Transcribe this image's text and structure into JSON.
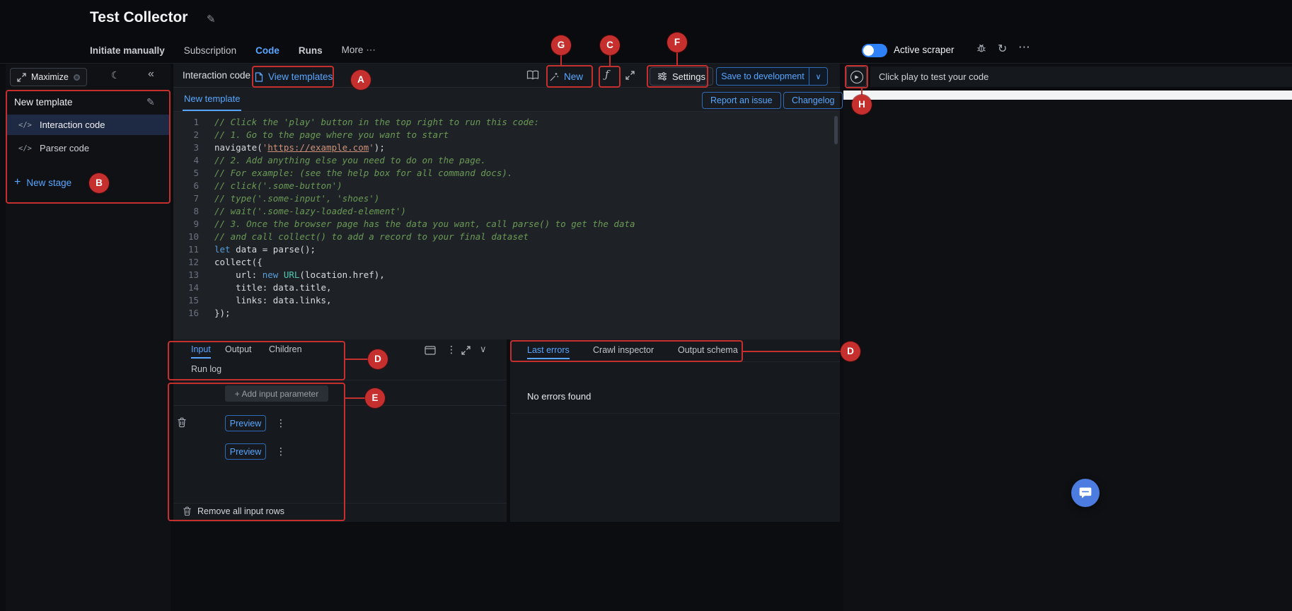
{
  "header": {
    "title": "Test Collector",
    "nav": [
      {
        "label": "Initiate manually"
      },
      {
        "label": "Subscription"
      },
      {
        "label": "Code"
      },
      {
        "label": "Runs"
      },
      {
        "label": "More"
      }
    ],
    "active_scraper": "Active scraper"
  },
  "sidebar": {
    "maximize": "Maximize",
    "template_title": "New template",
    "items": [
      {
        "label": "Interaction code"
      },
      {
        "label": "Parser code"
      }
    ],
    "new_stage": "New stage"
  },
  "editor": {
    "title": "Interaction code",
    "view_templates": "View templates",
    "new_button": "New",
    "settings": "Settings",
    "save": "Save to development",
    "tab": "New template",
    "report_issue": "Report an issue",
    "changelog": "Changelog"
  },
  "code": {
    "lines": [
      {
        "n": 1,
        "tokens": [
          {
            "t": "// Click the 'play' button in the top right to run this code:",
            "c": "comment"
          }
        ]
      },
      {
        "n": 2,
        "tokens": [
          {
            "t": "// 1. Go to the page where you want to start",
            "c": "comment"
          }
        ]
      },
      {
        "n": 3,
        "tokens": [
          {
            "t": "navigate(",
            "c": "plain"
          },
          {
            "t": "'",
            "c": "str"
          },
          {
            "t": "https://example.com",
            "c": "strlink"
          },
          {
            "t": "'",
            "c": "str"
          },
          {
            "t": ");",
            "c": "plain"
          }
        ]
      },
      {
        "n": 4,
        "tokens": [
          {
            "t": "// 2. Add anything else you need to do on the page.",
            "c": "comment"
          }
        ]
      },
      {
        "n": 5,
        "tokens": [
          {
            "t": "// For example: (see the help box for all command docs).",
            "c": "comment"
          }
        ]
      },
      {
        "n": 6,
        "tokens": [
          {
            "t": "// click('.some-button')",
            "c": "comment"
          }
        ]
      },
      {
        "n": 7,
        "tokens": [
          {
            "t": "// type('.some-input', 'shoes')",
            "c": "comment"
          }
        ]
      },
      {
        "n": 8,
        "tokens": [
          {
            "t": "// wait('.some-lazy-loaded-element')",
            "c": "comment"
          }
        ]
      },
      {
        "n": 9,
        "tokens": [
          {
            "t": "// 3. Once the browser page has the data you want, call parse() to get the data",
            "c": "comment"
          }
        ]
      },
      {
        "n": 10,
        "tokens": [
          {
            "t": "// and call collect() to add a record to your final dataset",
            "c": "comment"
          }
        ]
      },
      {
        "n": 11,
        "tokens": [
          {
            "t": "let ",
            "c": "kw"
          },
          {
            "t": "data = parse();",
            "c": "plain"
          }
        ]
      },
      {
        "n": 12,
        "tokens": [
          {
            "t": "collect({",
            "c": "plain"
          }
        ]
      },
      {
        "n": 13,
        "tokens": [
          {
            "t": "    url: ",
            "c": "plain"
          },
          {
            "t": "new ",
            "c": "kw"
          },
          {
            "t": "URL",
            "c": "type"
          },
          {
            "t": "(location.href),",
            "c": "plain"
          }
        ]
      },
      {
        "n": 14,
        "tokens": [
          {
            "t": "    title: data.title,",
            "c": "plain"
          }
        ]
      },
      {
        "n": 15,
        "tokens": [
          {
            "t": "    links: data.links,",
            "c": "plain"
          }
        ]
      },
      {
        "n": 16,
        "tokens": [
          {
            "t": "});",
            "c": "plain"
          }
        ]
      }
    ]
  },
  "bottom_left": {
    "tabs": [
      {
        "label": "Input"
      },
      {
        "label": "Output"
      },
      {
        "label": "Children"
      },
      {
        "label": "Run log"
      }
    ],
    "add_param": "+ Add input parameter",
    "rows": [
      {
        "button": "Preview"
      },
      {
        "button": "Preview"
      }
    ],
    "remove_all": "Remove all input rows"
  },
  "bottom_right": {
    "tabs": [
      {
        "label": "Last errors"
      },
      {
        "label": "Crawl inspector"
      },
      {
        "label": "Output schema"
      }
    ],
    "empty_message": "No errors found"
  },
  "right_panel": {
    "hint": "Click play to test your code"
  },
  "annotations": [
    {
      "letter": "A"
    },
    {
      "letter": "B"
    },
    {
      "letter": "C"
    },
    {
      "letter": "D"
    },
    {
      "letter": "D"
    },
    {
      "letter": "E"
    },
    {
      "letter": "F"
    },
    {
      "letter": "G"
    },
    {
      "letter": "H"
    }
  ],
  "icons": {
    "edit": "✎",
    "moon": "☾",
    "collapse": "«",
    "code": "</>",
    "plus": "+",
    "kebab": "⋮",
    "chevron_down": "∨",
    "ellipsis": "⋯",
    "fn": "ƒ",
    "history": "↻",
    "play": "▶"
  },
  "colors": {
    "accent": "#58a6ff",
    "annotation": "#c5302e"
  }
}
